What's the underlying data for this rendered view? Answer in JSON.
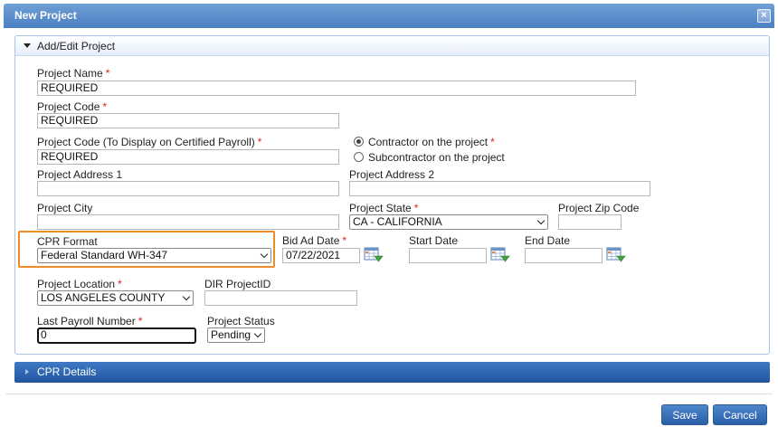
{
  "dialog": {
    "title": "New Project"
  },
  "section": {
    "title": "Add/Edit Project"
  },
  "form": {
    "project_name": {
      "label": "Project Name",
      "value": "REQUIRED"
    },
    "project_code": {
      "label": "Project Code",
      "value": "REQUIRED"
    },
    "project_code_cpr": {
      "label": "Project Code (To Display on Certified Payroll)",
      "value": "REQUIRED"
    },
    "contractor_role": {
      "options": [
        {
          "label": "Contractor on the project",
          "selected": true
        },
        {
          "label": "Subcontractor on the project",
          "selected": false
        }
      ]
    },
    "address1": {
      "label": "Project Address 1",
      "value": ""
    },
    "address2": {
      "label": "Project Address 2",
      "value": ""
    },
    "city": {
      "label": "Project City",
      "value": ""
    },
    "state": {
      "label": "Project State",
      "value": "CA - CALIFORNIA"
    },
    "zip": {
      "label": "Project Zip Code",
      "value": ""
    },
    "cpr_format": {
      "label": "CPR Format",
      "value": "Federal Standard WH-347"
    },
    "bid_ad_date": {
      "label": "Bid Ad Date",
      "value": "07/22/2021"
    },
    "start_date": {
      "label": "Start Date",
      "value": ""
    },
    "end_date": {
      "label": "End Date",
      "value": ""
    },
    "location": {
      "label": "Project Location",
      "value": "LOS ANGELES COUNTY"
    },
    "dir_project_id": {
      "label": "DIR ProjectID",
      "value": ""
    },
    "last_payroll_number": {
      "label": "Last Payroll Number",
      "value": "0"
    },
    "project_status": {
      "label": "Project Status",
      "value": "Pending"
    }
  },
  "cpr_details": {
    "title": "CPR Details"
  },
  "buttons": {
    "save": "Save",
    "cancel": "Cancel",
    "close": "×"
  },
  "colors": {
    "title_bar": "#4a7fc1",
    "required": "#e02020",
    "highlight": "#ef8a2a",
    "button": "#3a72bb"
  }
}
